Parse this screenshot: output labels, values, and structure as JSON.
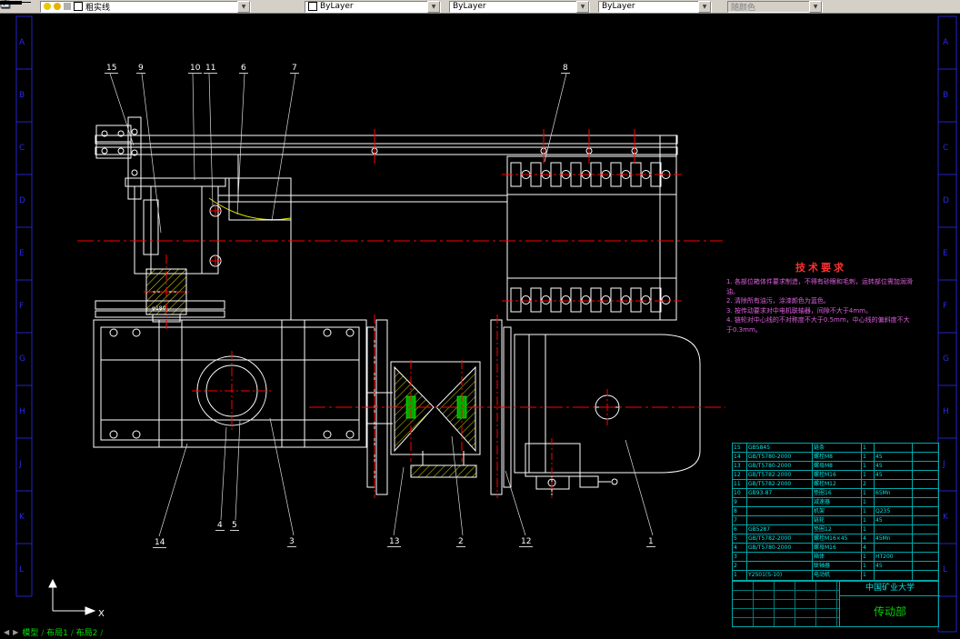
{
  "toolbar": {
    "layer": {
      "value": "粗实线"
    },
    "color": {
      "value": "ByLayer"
    },
    "linetype": {
      "value": "ByLayer"
    },
    "lineweight": {
      "value": "ByLayer"
    },
    "plot_style": {
      "value": "随颜色"
    }
  },
  "callouts": {
    "top": [
      "15",
      "9",
      "10",
      "11",
      "6",
      "7",
      "8"
    ],
    "bottom": [
      "14",
      "4",
      "5",
      "3",
      "13",
      "2",
      "12",
      "1"
    ]
  },
  "tech": {
    "title": "技术要求",
    "lines": [
      "1. 各部位箱体件要求制造，不得有砂眼和毛刺，运转部位需加润滑油。",
      "2. 清除所有油污，涂漆颜色为蓝色。",
      "3. 按传动要求对中电机联轴器，间隙不大于4mm。",
      "4. 链轮对中心线的不对称度不大于0.5mm，中心线的偏斜度不大于0.3mm。"
    ]
  },
  "bom": {
    "rows": [
      [
        "15",
        "GB5845",
        "链条",
        "1",
        "",
        ""
      ],
      [
        "14",
        "GB/T5780-2000",
        "螺栓M8",
        "1",
        "45",
        ""
      ],
      [
        "13",
        "GB/T5780-2000",
        "螺母M8",
        "1",
        "45",
        ""
      ],
      [
        "12",
        "GB/T5782-2000",
        "螺栓M16",
        "1",
        "45",
        ""
      ],
      [
        "11",
        "GB/T5782-2000",
        "螺栓M12",
        "2",
        "",
        ""
      ],
      [
        "10",
        "GB93-87",
        "垫圈16",
        "1",
        "65Mn",
        ""
      ],
      [
        "9",
        "",
        "减速器",
        "1",
        "",
        ""
      ],
      [
        "8",
        "",
        "机架",
        "1",
        "Q235",
        ""
      ],
      [
        "7",
        "",
        "链轮",
        "1",
        "45",
        ""
      ],
      [
        "6",
        "GB5287",
        "垫圈12",
        "1",
        "",
        ""
      ],
      [
        "5",
        "GB/T5782-2000",
        "螺栓M16×45",
        "4",
        "45Mn",
        ""
      ],
      [
        "4",
        "GB/T5780-2000",
        "螺母M16",
        "4",
        "",
        ""
      ],
      [
        "3",
        "",
        "箱体",
        "1",
        "HT200",
        ""
      ],
      [
        "2",
        "",
        "联轴器",
        "1",
        "45",
        ""
      ],
      [
        "1",
        "Y2S01(S-10)",
        "电动机",
        "1",
        "",
        ""
      ]
    ]
  },
  "title_block": {
    "university": "中国矿业大学",
    "drawing_title": "传动部"
  },
  "border": {
    "letters": [
      "A",
      "B",
      "C",
      "D",
      "E",
      "F",
      "G",
      "H",
      "J",
      "K",
      "L"
    ]
  },
  "tabs": {
    "items": [
      "模型",
      "布局1",
      "布局2"
    ]
  },
  "drawing": {
    "dim_label": "φ180"
  },
  "ucs": {
    "x_label": "X"
  },
  "colors": {
    "line": "#ffffff",
    "centerline": "#ff0000",
    "hatch": "#d8d800",
    "frame": "#2222cc",
    "bom": "#00e5e5",
    "note": "#df5fdf",
    "tab": "#00e000"
  }
}
